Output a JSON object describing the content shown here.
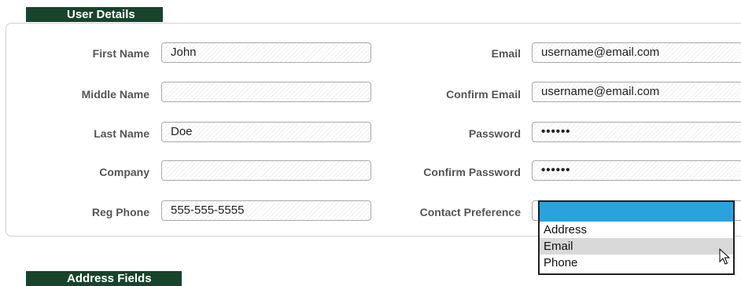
{
  "sections": {
    "user_details": "User Details",
    "address_fields": "Address Fields"
  },
  "left_fields": [
    {
      "label": "First Name",
      "value": "John"
    },
    {
      "label": "Middle Name",
      "value": ""
    },
    {
      "label": "Last Name",
      "value": "Doe"
    },
    {
      "label": "Company",
      "value": ""
    },
    {
      "label": "Reg Phone",
      "value": "555-555-5555"
    }
  ],
  "right_fields": [
    {
      "label": "Email",
      "value": "username@email.com"
    },
    {
      "label": "Confirm Email",
      "value": "username@email.com"
    },
    {
      "label": "Password",
      "value": "••••••"
    },
    {
      "label": "Confirm Password",
      "value": "••••••"
    },
    {
      "label": "Contact Preference",
      "value": ""
    }
  ],
  "contact_preference": {
    "selected": "",
    "options": [
      "Address",
      "Email",
      "Phone"
    ],
    "hovered": "Email"
  },
  "colors": {
    "section_tab": "#17442b",
    "dropdown_selected": "#2aa3dc",
    "dropdown_hover": "#d9d9d9"
  },
  "icons": {
    "cursor": "mouse-pointer-icon"
  }
}
